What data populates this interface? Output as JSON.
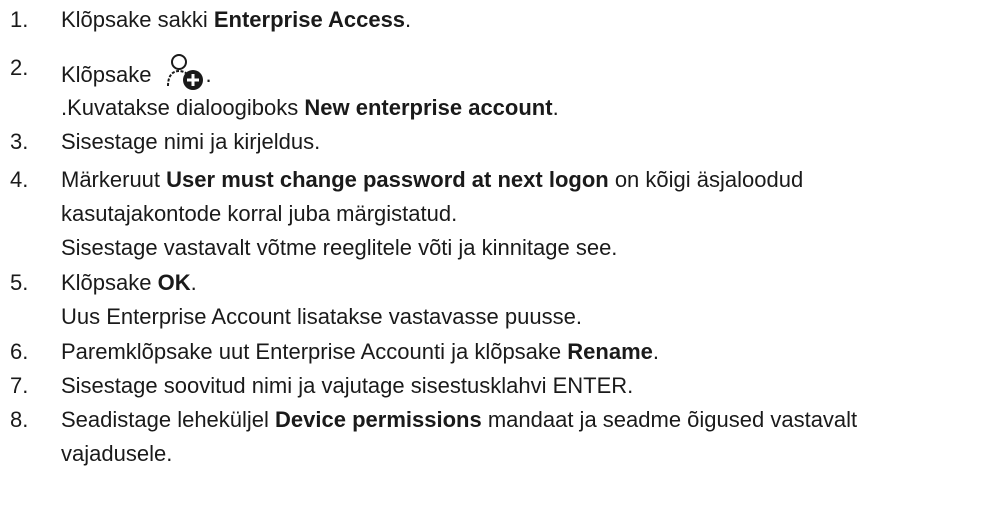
{
  "steps": [
    {
      "num": "1.",
      "lines": [
        [
          {
            "t": "Klõpsake sakki "
          },
          {
            "t": "Enterprise Access",
            "b": true
          },
          {
            "t": "."
          }
        ]
      ]
    },
    {
      "num": "2.",
      "lines": [
        [
          {
            "t": "Klõpsake"
          },
          {
            "icon": "add-user-icon"
          },
          {
            "t": "."
          }
        ],
        [
          {
            "t": ".Kuvatakse dialoogiboks "
          },
          {
            "t": "New enterprise account",
            "b": true
          },
          {
            "t": "."
          }
        ]
      ]
    },
    {
      "num": "3.",
      "lines": [
        [
          {
            "t": "Sisestage nimi ja kirjeldus."
          }
        ]
      ]
    },
    {
      "num": "4.",
      "lines": [
        [
          {
            "t": "Märkeruut "
          },
          {
            "t": "User must change password at next logon",
            "b": true
          },
          {
            "t": " on kõigi äsjaloodud"
          }
        ],
        [
          {
            "t": "kasutajakontode korral juba märgistatud."
          }
        ],
        [
          {
            "t": "Sisestage vastavalt võtme reeglitele võti ja kinnitage see."
          }
        ]
      ]
    },
    {
      "num": "5.",
      "lines": [
        [
          {
            "t": "Klõpsake "
          },
          {
            "t": "OK",
            "b": true
          },
          {
            "t": "."
          }
        ],
        [
          {
            "t": "Uus Enterprise Account lisatakse vastavasse puusse."
          }
        ]
      ]
    },
    {
      "num": "6.",
      "lines": [
        [
          {
            "t": "Paremklõpsake uut Enterprise Accounti ja klõpsake "
          },
          {
            "t": "Rename",
            "b": true
          },
          {
            "t": "."
          }
        ]
      ]
    },
    {
      "num": "7.",
      "lines": [
        [
          {
            "t": "Sisestage soovitud nimi ja vajutage sisestusklahvi ENTER."
          }
        ]
      ]
    },
    {
      "num": "8.",
      "lines": [
        [
          {
            "t": "Seadistage leheküljel "
          },
          {
            "t": "Device permissions",
            "b": true
          },
          {
            "t": " mandaat ja seadme õigused vastavalt"
          }
        ],
        [
          {
            "t": "vajadusele."
          }
        ]
      ]
    }
  ]
}
